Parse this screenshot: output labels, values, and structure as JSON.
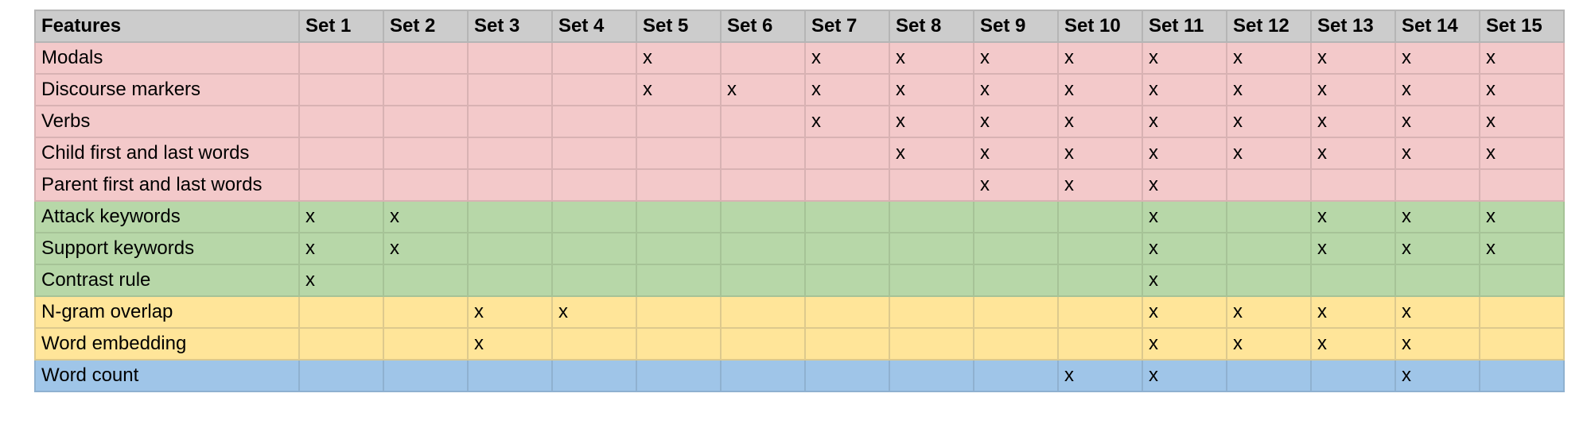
{
  "table": {
    "header": {
      "feature_label": "Features",
      "sets": [
        "Set 1",
        "Set 2",
        "Set 3",
        "Set 4",
        "Set 5",
        "Set 6",
        "Set 7",
        "Set 8",
        "Set 9",
        "Set 10",
        "Set 11",
        "Set 12",
        "Set 13",
        "Set 14",
        "Set 15"
      ]
    },
    "group_colors": {
      "red": "#f3c9ca",
      "green": "#b7d7a8",
      "yellow": "#ffe599",
      "blue": "#9fc5e8",
      "header": "#cccccc"
    },
    "rows": [
      {
        "feature": "Modals",
        "group": "red",
        "cells": [
          "",
          "",
          "",
          "",
          "x",
          "",
          "x",
          "x",
          "x",
          "x",
          "x",
          "x",
          "x",
          "x",
          "x"
        ]
      },
      {
        "feature": "Discourse markers",
        "group": "red",
        "cells": [
          "",
          "",
          "",
          "",
          "x",
          "x",
          "x",
          "x",
          "x",
          "x",
          "x",
          "x",
          "x",
          "x",
          "x"
        ]
      },
      {
        "feature": "Verbs",
        "group": "red",
        "cells": [
          "",
          "",
          "",
          "",
          "",
          "",
          "x",
          "x",
          "x",
          "x",
          "x",
          "x",
          "x",
          "x",
          "x"
        ]
      },
      {
        "feature": "Child first and last words",
        "group": "red",
        "cells": [
          "",
          "",
          "",
          "",
          "",
          "",
          "",
          "x",
          "x",
          "x",
          "x",
          "x",
          "x",
          "x",
          "x"
        ]
      },
      {
        "feature": "Parent first and last words",
        "group": "red",
        "cells": [
          "",
          "",
          "",
          "",
          "",
          "",
          "",
          "",
          "x",
          "x",
          "x",
          "",
          "",
          "",
          ""
        ]
      },
      {
        "feature": "Attack keywords",
        "group": "green",
        "cells": [
          "x",
          "x",
          "",
          "",
          "",
          "",
          "",
          "",
          "",
          "",
          "x",
          "",
          "x",
          "x",
          "x"
        ]
      },
      {
        "feature": "Support keywords",
        "group": "green",
        "cells": [
          "x",
          "x",
          "",
          "",
          "",
          "",
          "",
          "",
          "",
          "",
          "x",
          "",
          "x",
          "x",
          "x"
        ]
      },
      {
        "feature": "Contrast rule",
        "group": "green",
        "cells": [
          "x",
          "",
          "",
          "",
          "",
          "",
          "",
          "",
          "",
          "",
          "x",
          "",
          "",
          "",
          ""
        ]
      },
      {
        "feature": "N-gram overlap",
        "group": "yellow",
        "cells": [
          "",
          "",
          "x",
          "x",
          "",
          "",
          "",
          "",
          "",
          "",
          "x",
          "x",
          "x",
          "x",
          ""
        ]
      },
      {
        "feature": "Word embedding",
        "group": "yellow",
        "cells": [
          "",
          "",
          "x",
          "",
          "",
          "",
          "",
          "",
          "",
          "",
          "x",
          "x",
          "x",
          "x",
          ""
        ]
      },
      {
        "feature": "Word count",
        "group": "blue",
        "cells": [
          "",
          "",
          "",
          "",
          "",
          "",
          "",
          "",
          "",
          "x",
          "x",
          "",
          "",
          "x",
          ""
        ]
      }
    ]
  }
}
